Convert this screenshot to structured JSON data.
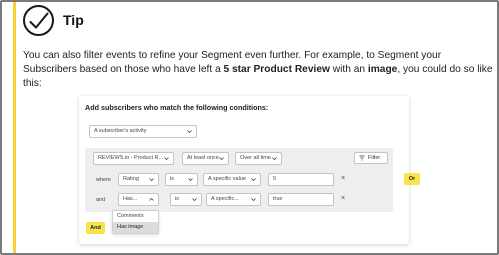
{
  "tip": {
    "title": "Tip",
    "icon": "checkmark-circle-icon"
  },
  "body": {
    "part1": "You can also filter events to refine your Segment even further. For example, to Segment your Subscribers based on those who have left a ",
    "bold1": "5 star Product Review",
    "part2": " with an ",
    "bold2": "image",
    "part3": ", you could do so like this:"
  },
  "card": {
    "heading": "Add subscribers who match the following conditions:",
    "activity_select": "A subscriber's activity",
    "row1": {
      "event": "REVIEWS.io - Product R...",
      "frequency": "At least once",
      "timeframe": "Over all time",
      "filter_label": "Filter"
    },
    "row2": {
      "prefix": "where",
      "property": "Rating",
      "operator": "is",
      "value_type": "A specific value",
      "value": "5",
      "remove": "×"
    },
    "row3": {
      "prefix": "and",
      "property": "Has...",
      "operator": "is",
      "value_type": "A specific...",
      "value": "true",
      "remove": "×"
    },
    "or_label": "Or",
    "and_label": "And",
    "dropdown_options": [
      "Comments",
      "Has image"
    ],
    "dropdown_selected_index": 1
  },
  "colors": {
    "accent": "#f7d233",
    "button_yellow": "#f7e34a",
    "panel_gray": "#eeeeee"
  }
}
